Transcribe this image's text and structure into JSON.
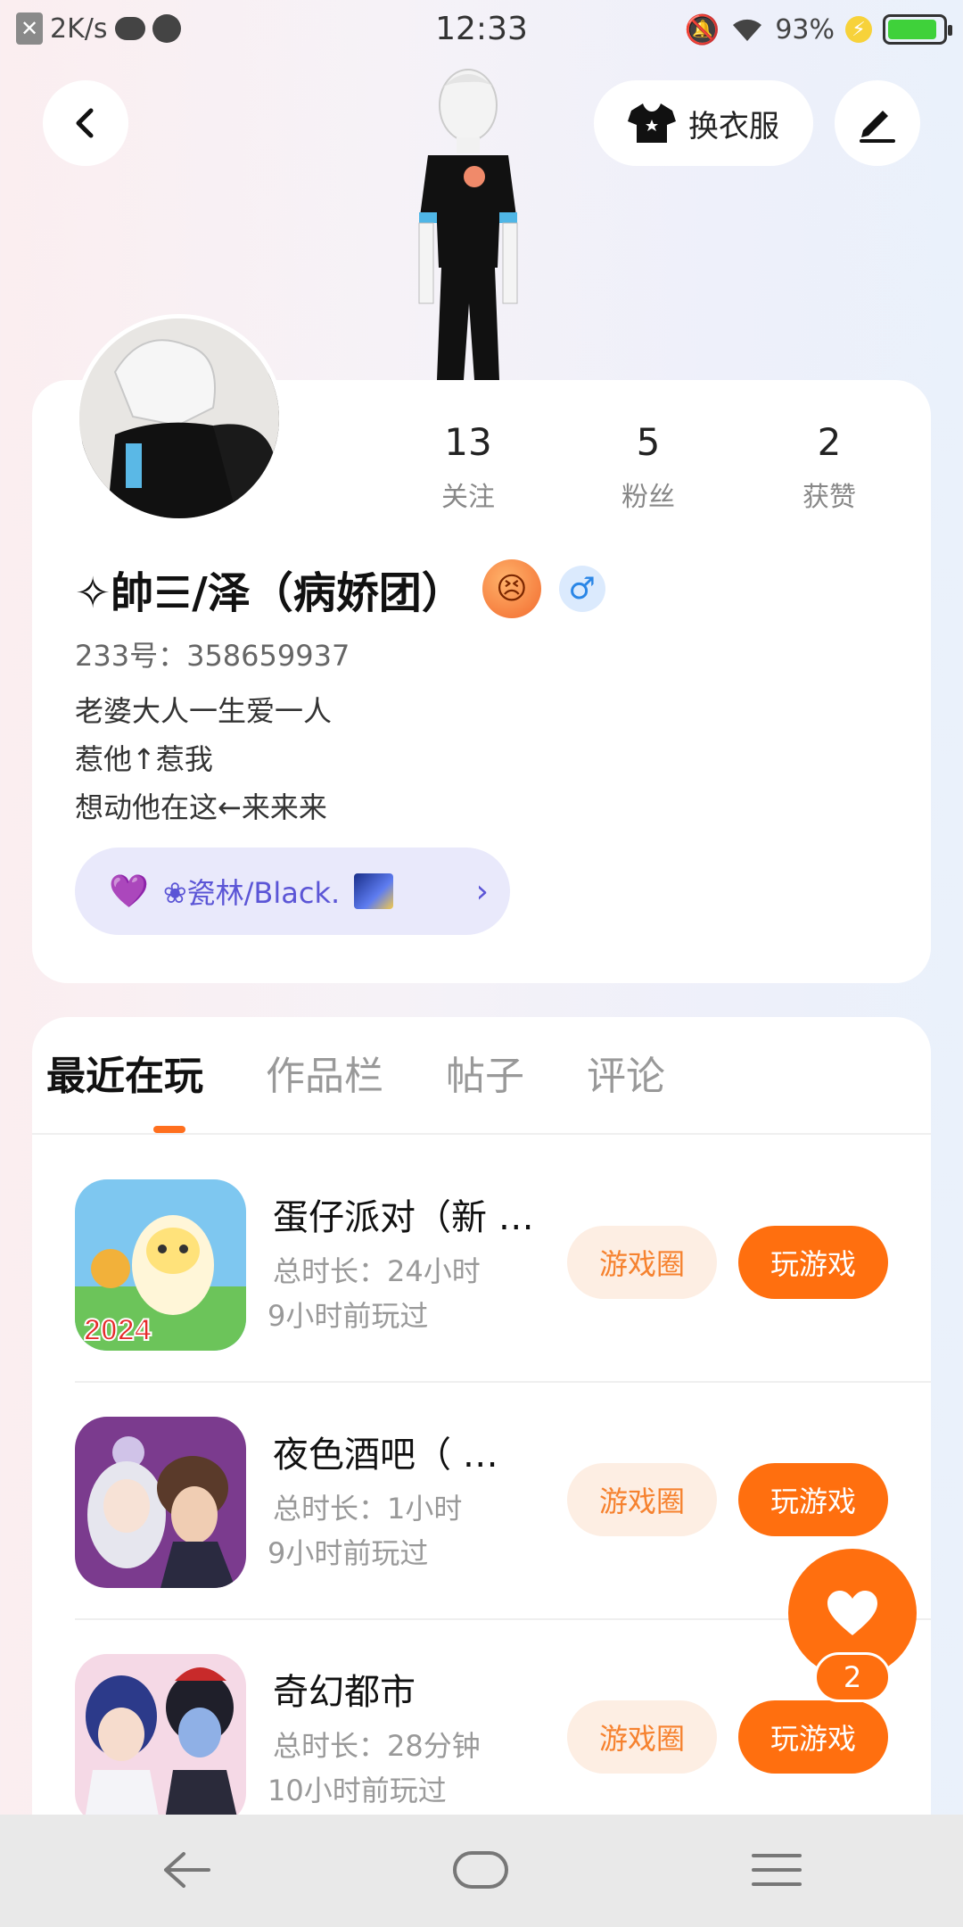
{
  "status_bar": {
    "network_speed": "2K/s",
    "time": "12:33",
    "battery": "93%"
  },
  "header": {
    "outfit_label": "换衣服"
  },
  "profile": {
    "following_count": "13",
    "following_label": "关注",
    "fans_count": "5",
    "fans_label": "粉丝",
    "likes_count": "2",
    "likes_label": "获赞",
    "username": "✧帥☰/泽（病娇团）",
    "gender_symbol": "♂",
    "uid": "233号：358659937",
    "bio_lines": [
      "老婆大人一生爱一人",
      "惹他↑惹我",
      "想动他在这←来来来"
    ],
    "group_name": "❀瓷林/Black."
  },
  "tabs": [
    {
      "label": "最近在玩",
      "active": true
    },
    {
      "label": "作品栏",
      "active": false
    },
    {
      "label": "帖子",
      "active": false
    },
    {
      "label": "评论",
      "active": false
    }
  ],
  "games": [
    {
      "title": "蛋仔派对（新 …",
      "duration": "总时长：24小时",
      "last_played": "9小时前玩过",
      "circle_label": "游戏圈",
      "play_label": "玩游戏",
      "icon_text": "2024"
    },
    {
      "title": "夜色酒吧（ …",
      "duration": "总时长：1小时",
      "last_played": "9小时前玩过",
      "circle_label": "游戏圈",
      "play_label": "玩游戏"
    },
    {
      "title": "奇幻都市",
      "duration": "总时长：28分钟",
      "last_played": "10小时前玩过",
      "circle_label": "游戏圈",
      "play_label": "玩游戏"
    }
  ],
  "like_fab": {
    "count": "2"
  },
  "colors": {
    "accent": "#ff6f0f",
    "accent_light": "#fdeee3",
    "chip_bg": "#e9e9fb",
    "chip_text": "#5b55d6"
  },
  "icons": [
    "back-arrow-icon",
    "tshirt-icon",
    "pen-icon",
    "heart-icon",
    "nav-back-icon",
    "nav-home-icon",
    "nav-menu-icon"
  ]
}
